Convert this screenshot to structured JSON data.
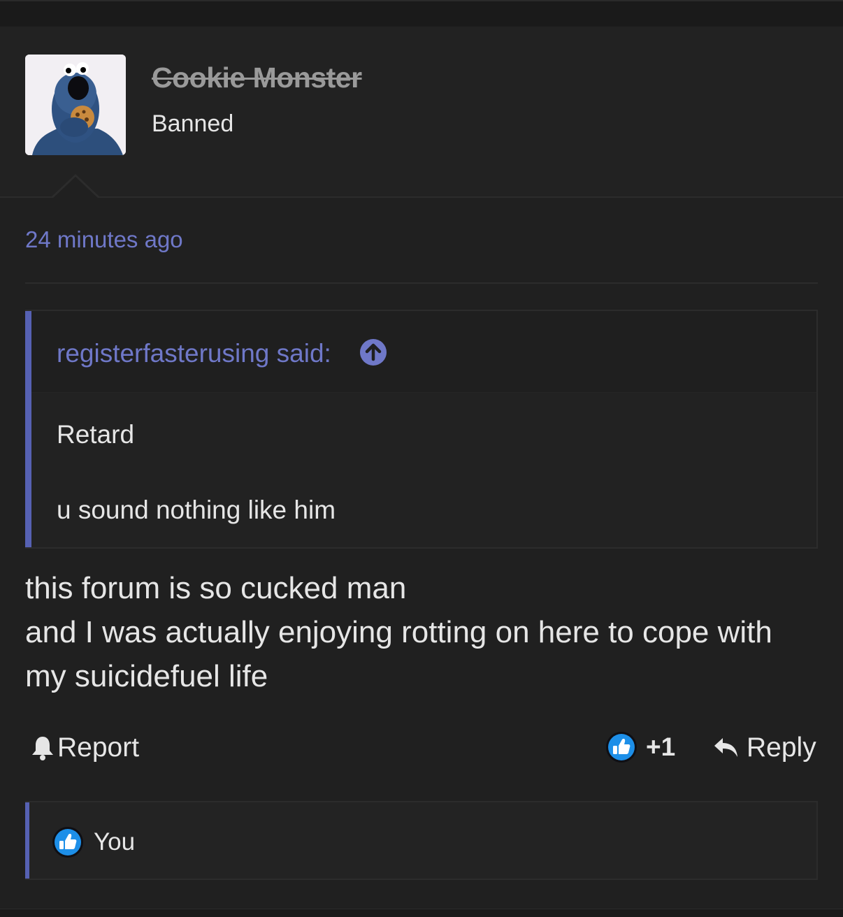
{
  "post": {
    "username": "Cookie Monster",
    "user_title": "Banned",
    "timestamp": "24 minutes ago",
    "quote": {
      "author_line": "registerfasterusing said:",
      "lines": [
        "Retard",
        "u sound nothing like him"
      ]
    },
    "message_lines": [
      "this forum is so cucked man",
      "and I was actually enjoying rotting on here to cope with",
      "my suicidefuel life"
    ],
    "actions": {
      "report_label": "Report",
      "like_count": "+1",
      "reply_label": "Reply"
    },
    "liked_by": "You"
  },
  "colors": {
    "accent": "#6f78c8",
    "quote_bar": "#5661b3",
    "like_blue": "#1d8fe8"
  },
  "icons": [
    "avatar-cookie-monster",
    "arrow-up-circle-icon",
    "bell-icon",
    "thumbs-up-icon",
    "reply-arrow-icon"
  ]
}
